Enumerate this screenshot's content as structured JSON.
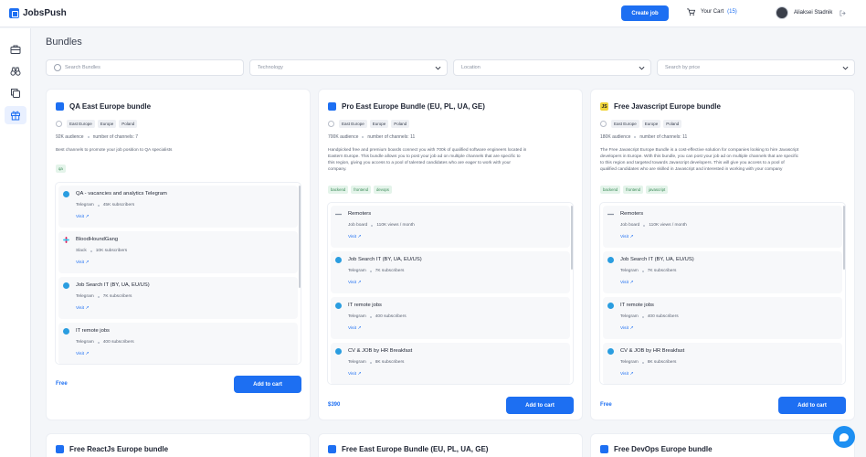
{
  "app": {
    "name": "JobsPush"
  },
  "header": {
    "create_job": "Create job",
    "cart_label": "Your Cart",
    "cart_count": "(15)",
    "user_name": "Aliaksei Stadnik"
  },
  "sidebar": {
    "items": [
      "briefcase-icon",
      "binoculars-icon",
      "copy-icon",
      "gift-icon"
    ],
    "active": "gift-icon"
  },
  "page": {
    "title": "Bundles"
  },
  "filters": {
    "search_placeholder": "Search Bundles",
    "technology": "Technology",
    "location": "Location",
    "price": "Search by price"
  },
  "cards": [
    {
      "title": "QA East Europe bundle",
      "icon": "bundle-icon",
      "regions": [
        "East Europe",
        "Europe",
        "Poland"
      ],
      "audience": "92K audience",
      "channels_count": "number of channels: 7",
      "description": [
        "Best channels to promote your job position to QA specialists"
      ],
      "tech": [
        "qa"
      ],
      "channels": [
        {
          "name": "QA - vacancies and analytics Telegram",
          "type": "Telegram",
          "subs": "45K subscribers",
          "visit": "Visit"
        },
        {
          "name": "BloodHoundGang",
          "type": "Slack",
          "subs": "10K subscribers",
          "visit": "Visit"
        },
        {
          "name": "Job Search IT (BY, UA, EU/US)",
          "type": "Telegram",
          "subs": "7K subscribers",
          "visit": "Visit"
        },
        {
          "name": "IT remote jobs",
          "type": "Telegram",
          "subs": "400 subscribers",
          "visit": "Visit"
        }
      ],
      "price": "Free",
      "button": "Add to cart"
    },
    {
      "title": "Pro East Europe Bundle (EU, PL, UA, GE)",
      "icon": "bundle-icon",
      "regions": [
        "East Europe",
        "Europe",
        "Poland"
      ],
      "audience": "700K audience",
      "channels_count": "number of channels: 11",
      "description": [
        "Handpicked free and premium boards connect you with 700k of qualified software engineers located in",
        "Eastern Europe. This bundle allows you to post your job ad on multiple channels that are specific to",
        "this region, giving you access to a pool of talented candidates who are eager to work with your",
        "company."
      ],
      "tech": [
        "backend",
        "frontend",
        "devops"
      ],
      "channels": [
        {
          "name": "Remoters",
          "type": "Job board",
          "subs": "110K views / month",
          "visit": "Visit"
        },
        {
          "name": "Job Search IT (BY, UA, EU/US)",
          "type": "Telegram",
          "subs": "7K subscribers",
          "visit": "Visit"
        },
        {
          "name": "IT remote jobs",
          "type": "Telegram",
          "subs": "400 subscribers",
          "visit": "Visit"
        },
        {
          "name": "CV & JOB by HR Breakfast",
          "type": "Telegram",
          "subs": "8K subscribers",
          "visit": "Visit"
        }
      ],
      "price": "$390",
      "button": "Add to cart"
    },
    {
      "title": "Free Javascript Europe bundle",
      "icon": "js-icon",
      "regions": [
        "East Europe",
        "Europe",
        "Poland"
      ],
      "audience": "180K audience",
      "channels_count": "number of channels: 11",
      "description": [
        "The Free Javascript Europe Bundle is a cost-effective solution for companies looking to hire Javascript",
        "developers in Europe. With this bundle, you can post your job ad on multiple channels that are specific",
        "to this region and targeted towards Javascript developers. This will give you access to a pool of",
        "qualified candidates who are skilled in Javascript and interested in working with your company"
      ],
      "tech": [
        "backend",
        "frontend",
        "javascript"
      ],
      "channels": [
        {
          "name": "Remoters",
          "type": "Job board",
          "subs": "110K views / month",
          "visit": "Visit"
        },
        {
          "name": "Job Search IT (BY, UA, EU/US)",
          "type": "Telegram",
          "subs": "7K subscribers",
          "visit": "Visit"
        },
        {
          "name": "IT remote jobs",
          "type": "Telegram",
          "subs": "400 subscribers",
          "visit": "Visit"
        },
        {
          "name": "CV & JOB by HR Breakfast",
          "type": "Telegram",
          "subs": "8K subscribers",
          "visit": "Visit"
        }
      ],
      "price": "Free",
      "button": "Add to cart"
    }
  ],
  "next_row": [
    "Free ReactJs Europe bundle",
    "Free East Europe Bundle (EU, PL, UA, GE)",
    "Free DevOps Europe bundle"
  ],
  "colors": {
    "accent": "#1d6ff2",
    "background": "#f4f6f9",
    "tech_tag": "#e4f4ea"
  }
}
